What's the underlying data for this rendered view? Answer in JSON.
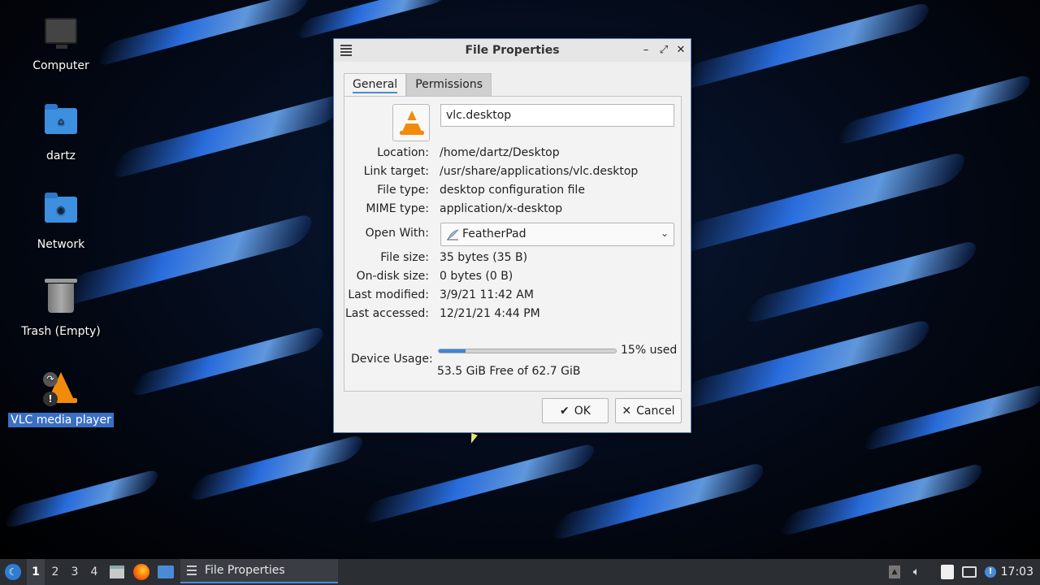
{
  "desktop": {
    "icons": [
      {
        "label": "Computer",
        "icon": "computer-icon"
      },
      {
        "label": "dartz",
        "icon": "home-folder-icon"
      },
      {
        "label": "Network",
        "icon": "network-folder-icon"
      },
      {
        "label": "Trash (Empty)",
        "icon": "trash-icon"
      },
      {
        "label": "VLC media player",
        "icon": "vlc-icon"
      }
    ]
  },
  "dialog": {
    "title": "File Properties",
    "controls": {
      "minimize": "–",
      "maximize": "⤢",
      "close": "✕"
    },
    "tabs": [
      {
        "label": "General"
      },
      {
        "label": "Permissions"
      }
    ],
    "file_name": "vlc.desktop",
    "fields": {
      "location": {
        "label": "Location:",
        "value": "/home/dartz/Desktop"
      },
      "link_target": {
        "label": "Link target:",
        "value": "/usr/share/applications/vlc.desktop"
      },
      "file_type": {
        "label": "File type:",
        "value": "desktop configuration file"
      },
      "mime_type": {
        "label": "MIME type:",
        "value": "application/x-desktop"
      },
      "open_with": {
        "label": "Open With:",
        "value": "FeatherPad"
      },
      "file_size": {
        "label": "File size:",
        "value": "35 bytes (35 B)"
      },
      "disk_size": {
        "label": "On-disk size:",
        "value": "0 bytes (0 B)"
      },
      "last_modified": {
        "label": "Last modified:",
        "value": "3/9/21 11:42 AM"
      },
      "last_accessed": {
        "label": "Last accessed:",
        "value": "12/21/21 4:44 PM"
      }
    },
    "device_usage": {
      "label": "Device Usage:",
      "percent_used": 15,
      "percent_text": "15% used",
      "free_text": "53.5 GiB Free of 62.7 GiB"
    },
    "buttons": {
      "ok": "OK",
      "cancel": "Cancel"
    }
  },
  "taskbar": {
    "workspaces": [
      "1",
      "2",
      "3",
      "4"
    ],
    "active_workspace": "1",
    "task_title": "File Properties",
    "clock": "17:03"
  },
  "colors": {
    "accent": "#4a8bd8",
    "vlc_orange": "#f28b0c",
    "taskbar": "#2b2e33"
  }
}
